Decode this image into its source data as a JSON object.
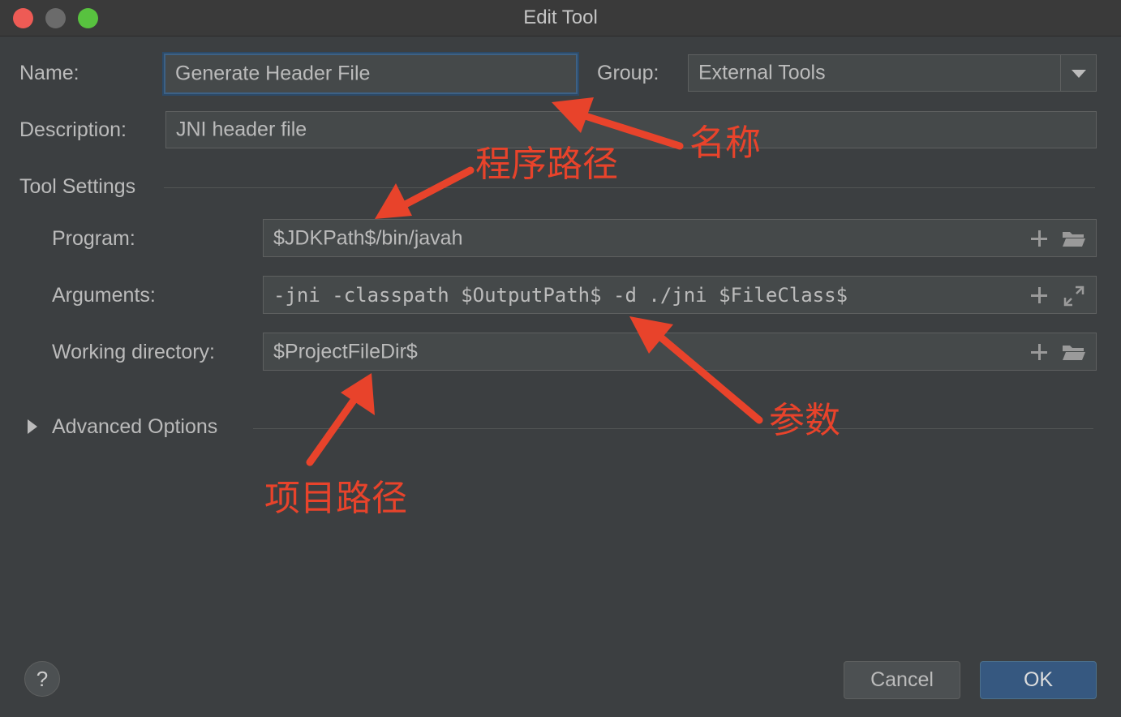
{
  "window": {
    "title": "Edit Tool"
  },
  "form": {
    "name_label": "Name:",
    "name_value": "Generate Header File",
    "group_label": "Group:",
    "group_value": "External Tools",
    "description_label": "Description:",
    "description_value": "JNI header file"
  },
  "tool_settings": {
    "section_title": "Tool Settings",
    "program_label": "Program:",
    "program_value": "$JDKPath$/bin/javah",
    "arguments_label": "Arguments:",
    "arguments_value": "-jni -classpath $OutputPath$ -d ./jni $FileClass$",
    "working_dir_label": "Working directory:",
    "working_dir_value": "$ProjectFileDir$"
  },
  "advanced": {
    "label": "Advanced Options"
  },
  "buttons": {
    "help": "?",
    "cancel": "Cancel",
    "ok": "OK"
  },
  "annotations": {
    "name": "名称",
    "program_path": "程序路径",
    "arguments": "参数",
    "project_path": "项目路径"
  },
  "colors": {
    "background": "#3c3f41",
    "field": "#45494a",
    "focus": "#3d6185",
    "ok_button": "#365880",
    "annotation": "#e8432b"
  },
  "icons": {
    "add": "plus-icon",
    "browse": "folder-icon",
    "expand": "expand-icon",
    "dropdown": "chevron-down-icon",
    "disclosure": "triangle-right-icon"
  }
}
